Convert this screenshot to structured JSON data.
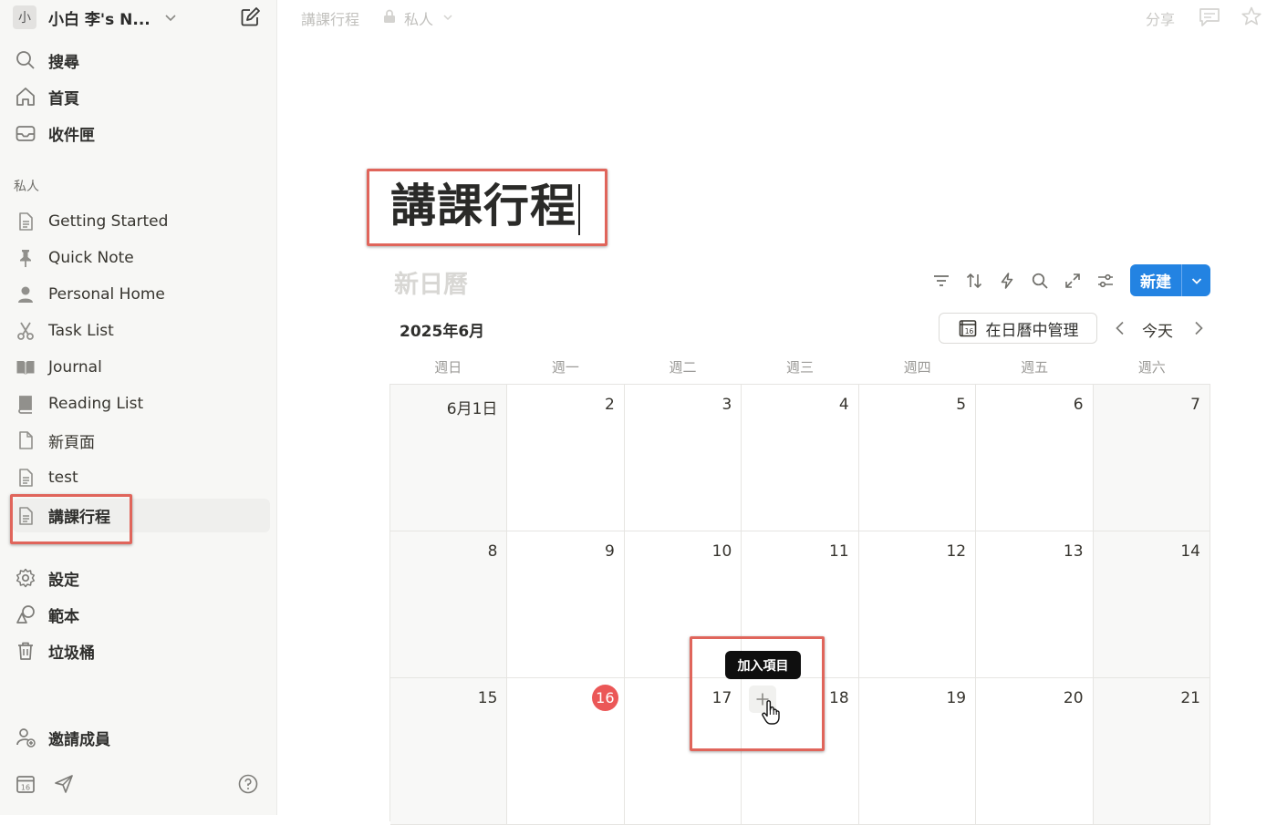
{
  "sidebar": {
    "workspace": {
      "avatar": "小",
      "name": "小白 李's N..."
    },
    "top_items": [
      {
        "icon": "search-icon",
        "label": "搜尋"
      },
      {
        "icon": "home-icon",
        "label": "首頁"
      },
      {
        "icon": "inbox-icon",
        "label": "收件匣"
      }
    ],
    "section_label": "私人",
    "pages": [
      {
        "icon": "page-icon",
        "label": "Getting Started"
      },
      {
        "icon": "pin-icon",
        "label": "Quick Note"
      },
      {
        "icon": "person-icon",
        "label": "Personal Home"
      },
      {
        "icon": "scissors-icon",
        "label": "Task List"
      },
      {
        "icon": "book-open-icon",
        "label": "Journal"
      },
      {
        "icon": "book-icon",
        "label": "Reading List"
      },
      {
        "icon": "blank-page-icon",
        "label": "新頁面"
      },
      {
        "icon": "page-icon",
        "label": "test"
      },
      {
        "icon": "page-icon",
        "label": "講課行程"
      }
    ],
    "utility_items": [
      {
        "icon": "gear-icon",
        "label": "設定"
      },
      {
        "icon": "templates-icon",
        "label": "範本"
      },
      {
        "icon": "trash-icon",
        "label": "垃圾桶"
      }
    ],
    "invite": {
      "icon": "invite-user-icon",
      "label": "邀請成員"
    },
    "bottom_icons": [
      "calendar-icon",
      "send-icon",
      "help-icon"
    ]
  },
  "topbar": {
    "breadcrumb": "講課行程",
    "privacy": "私人",
    "share": "分享"
  },
  "page": {
    "title": "講課行程",
    "database_title": "新日曆",
    "new_button": "新建",
    "toolbar_icons": [
      "filter-icon",
      "sort-icon",
      "automation-icon",
      "search-icon",
      "expand-icon",
      "settings-sliders-icon"
    ]
  },
  "calendar": {
    "month_label": "2025年6月",
    "manage_button": "在日曆中管理",
    "manage_icon_day": "16",
    "today_button": "今天",
    "weekdays": [
      "週日",
      "週一",
      "週二",
      "週三",
      "週四",
      "週五",
      "週六"
    ],
    "weeks": [
      [
        "6月1日",
        "2",
        "3",
        "4",
        "5",
        "6",
        "7"
      ],
      [
        "8",
        "9",
        "10",
        "11",
        "12",
        "13",
        "14"
      ],
      [
        "15",
        "16",
        "17",
        "18",
        "19",
        "20",
        "21"
      ]
    ],
    "today_day": "16",
    "add_tooltip": "加入項目"
  },
  "colors": {
    "accent": "#2383e2",
    "today_badge": "#eb5757",
    "highlight": "#e0655b"
  }
}
